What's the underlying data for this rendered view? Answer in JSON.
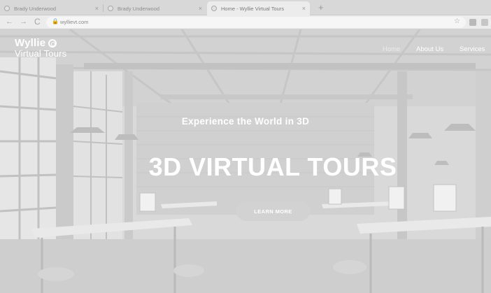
{
  "browser": {
    "tabs": [
      {
        "title": "Brady Underwood",
        "close": "×"
      },
      {
        "title": "Brady Underwood",
        "close": "×"
      },
      {
        "title": "Home - Wyllie Virtual Tours",
        "close": "×"
      }
    ],
    "new_tab": "+",
    "nav": {
      "back": "←",
      "forward": "→",
      "reload": "C"
    },
    "address": {
      "lock": "🔒",
      "url": "wyllievt.com",
      "star": "☆"
    }
  },
  "site": {
    "logo": {
      "line1": "Wyllie",
      "line2": "Virtual Tours",
      "mark_icon": "camera-lens-icon"
    },
    "nav": [
      {
        "label": "Home"
      },
      {
        "label": "About Us"
      },
      {
        "label": "Services"
      }
    ],
    "hero": {
      "tagline": "Experience the World in 3D",
      "headline": "3D VIRTUAL TOURS",
      "cta_label": "LEARN MORE"
    }
  },
  "colors": {
    "hero_background": "#d9d9d9",
    "text": "#ffffff"
  }
}
